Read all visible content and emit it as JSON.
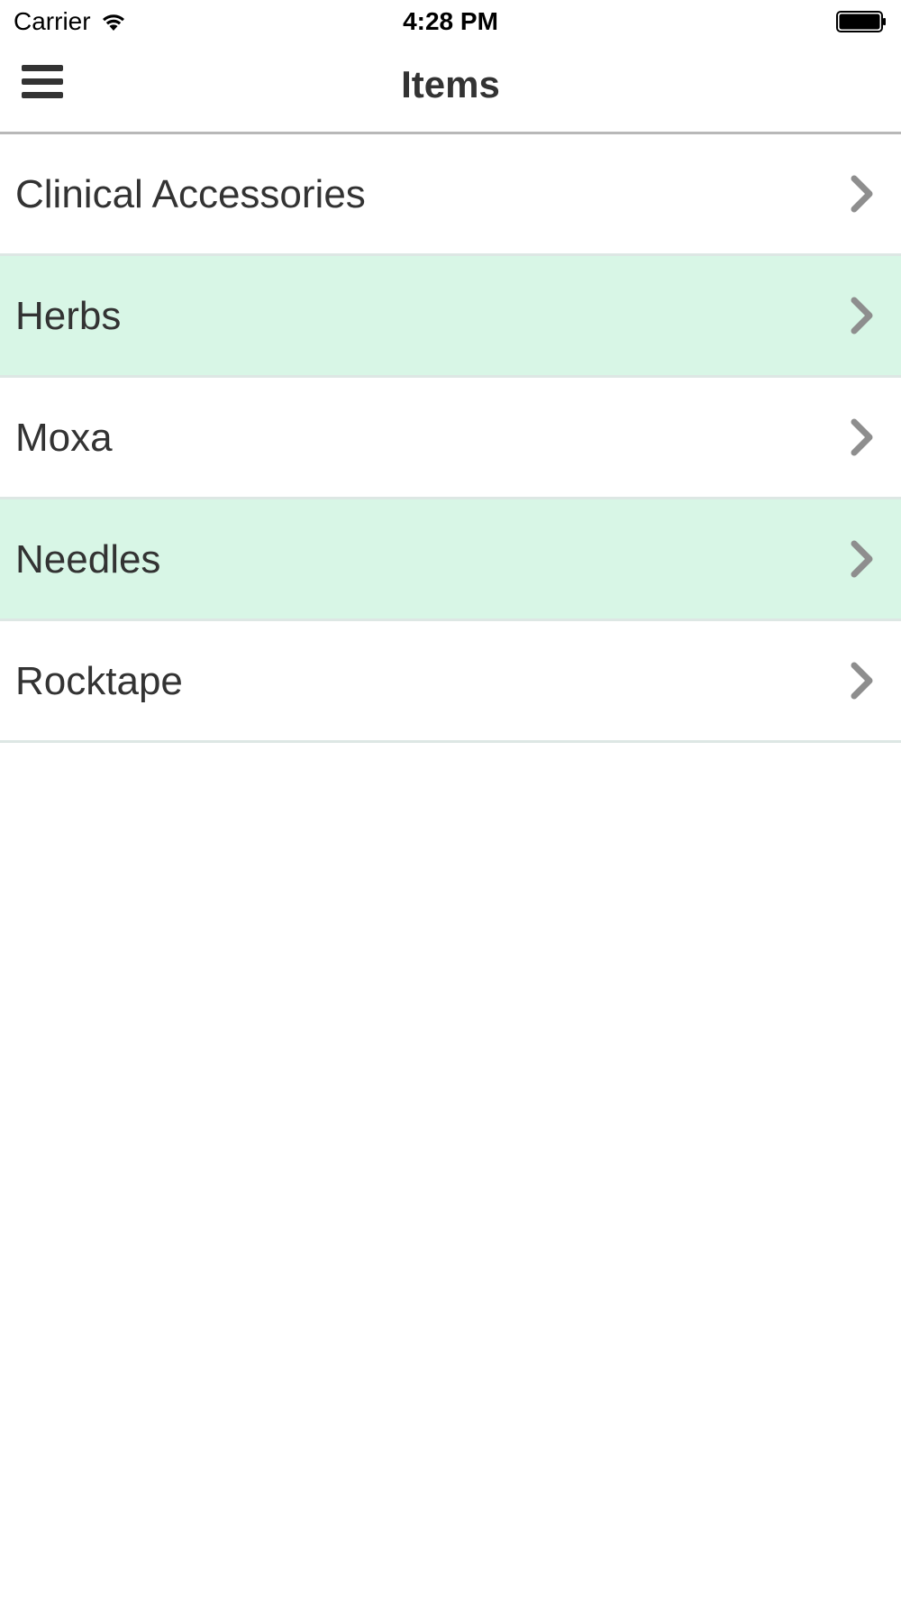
{
  "status_bar": {
    "carrier": "Carrier",
    "time": "4:28 PM",
    "wifi_icon": "wifi-icon",
    "battery_icon": "battery-icon"
  },
  "nav": {
    "title": "Items",
    "menu_icon": "hamburger-menu-icon"
  },
  "list": {
    "items": [
      {
        "label": "Clinical Accessories",
        "highlighted": false
      },
      {
        "label": "Herbs",
        "highlighted": true
      },
      {
        "label": "Moxa",
        "highlighted": false
      },
      {
        "label": "Needles",
        "highlighted": true
      },
      {
        "label": "Rocktape",
        "highlighted": false
      }
    ],
    "chevron_icon": "chevron-right-icon"
  },
  "colors": {
    "highlight_row": "#d8f6e6",
    "text": "#333333",
    "divider": "#dde7e4",
    "chevron": "#8e8e8e"
  }
}
